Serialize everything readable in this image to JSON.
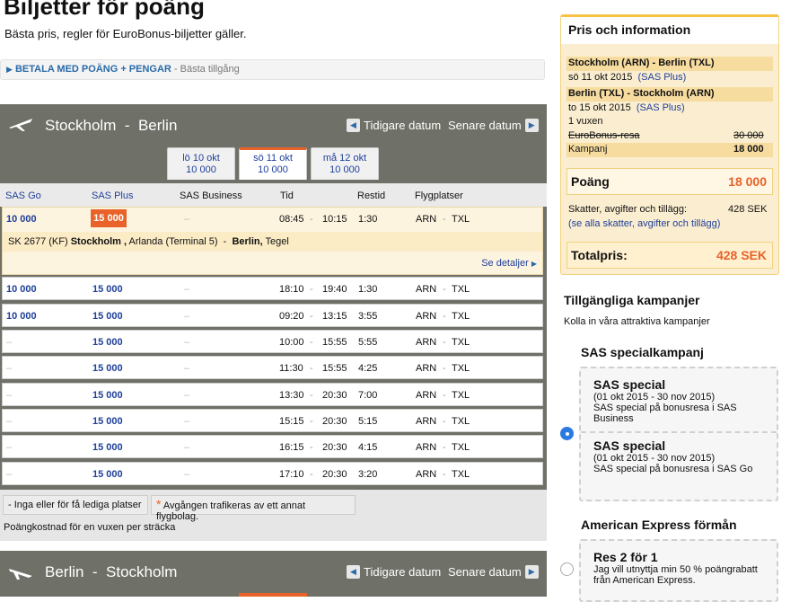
{
  "header": {
    "title": "Biljetter för poäng",
    "subtitle": "Bästa pris, regler för EuroBonus-biljetter gäller.",
    "pay_link": "BETALA MED POÄNG + PENGAR",
    "pay_suffix": "- Bästa tillgång"
  },
  "outbound": {
    "from": "Stockholm",
    "to": "Berlin",
    "prev_label": "Tidigare datum",
    "next_label": "Senare datum",
    "tabs": [
      {
        "day": "lö 10 okt",
        "points": "10 000"
      },
      {
        "day": "sö 11 okt",
        "points": "10 000"
      },
      {
        "day": "må 12 okt",
        "points": "10 000"
      }
    ],
    "columns": [
      "SAS Go",
      "SAS Plus",
      "SAS Business",
      "Tid",
      "Restid",
      "Flygplatser"
    ],
    "rows": [
      {
        "go": "10 000",
        "plus": "15 000",
        "biz": "–",
        "dep": "08:45",
        "arr": "10:15",
        "dur": "1:30",
        "from": "ARN",
        "to": "TXL"
      },
      {
        "go": "10 000",
        "plus": "15 000",
        "biz": "–",
        "dep": "18:10",
        "arr": "19:40",
        "dur": "1:30",
        "from": "ARN",
        "to": "TXL"
      },
      {
        "go": "10 000",
        "plus": "15 000",
        "biz": "–",
        "dep": "09:20",
        "arr": "13:15",
        "dur": "3:55",
        "from": "ARN",
        "to": "TXL"
      },
      {
        "go": "–",
        "plus": "15 000",
        "biz": "–",
        "dep": "10:00",
        "arr": "15:55",
        "dur": "5:55",
        "from": "ARN",
        "to": "TXL"
      },
      {
        "go": "–",
        "plus": "15 000",
        "biz": "–",
        "dep": "11:30",
        "arr": "15:55",
        "dur": "4:25",
        "from": "ARN",
        "to": "TXL"
      },
      {
        "go": "–",
        "plus": "15 000",
        "biz": "–",
        "dep": "13:30",
        "arr": "20:30",
        "dur": "7:00",
        "from": "ARN",
        "to": "TXL"
      },
      {
        "go": "–",
        "plus": "15 000",
        "biz": "–",
        "dep": "15:15",
        "arr": "20:30",
        "dur": "5:15",
        "from": "ARN",
        "to": "TXL"
      },
      {
        "go": "–",
        "plus": "15 000",
        "biz": "–",
        "dep": "16:15",
        "arr": "20:30",
        "dur": "4:15",
        "from": "ARN",
        "to": "TXL"
      },
      {
        "go": "–",
        "plus": "15 000",
        "biz": "–",
        "dep": "17:10",
        "arr": "20:30",
        "dur": "3:20",
        "from": "ARN",
        "to": "TXL"
      }
    ],
    "detail": {
      "flight": "SK 2677 (KF)",
      "from_city": "Stockholm ,",
      "from_airport": "Arlanda  (Terminal 5)",
      "to_city": "Berlin,",
      "to_airport": "Tegel",
      "link": "Se detaljer"
    },
    "legend1": "- Inga eller för få lediga platser",
    "legend2": "Avgången trafikeras av ett annat flygbolag.",
    "note": "Poängkostnad för en vuxen per sträcka"
  },
  "return": {
    "from": "Berlin",
    "to": "Stockholm",
    "prev_label": "Tidigare datum",
    "next_label": "Senare datum"
  },
  "summary": {
    "title": "Pris och information",
    "out_route": "Stockholm (ARN) - Berlin (TXL)",
    "out_date": "sö 11 okt 2015",
    "out_class": "(SAS Plus)",
    "ret_route": "Berlin (TXL) - Stockholm (ARN)",
    "ret_date": "to 15 okt 2015",
    "ret_class": "(SAS Plus)",
    "passengers": "1 vuxen",
    "eb_label": "EuroBonus-resa",
    "eb_value": "30 000",
    "kampanj_label": "Kampanj",
    "kampanj_value": "18 000",
    "poang_label": "Poäng",
    "poang_value": "18 000",
    "tax_label": "Skatter, avgifter och tillägg:",
    "tax_value": "428  SEK",
    "tax_link": "(se alla skatter, avgifter och tillägg)",
    "total_label": "Totalpris:",
    "total_value": "428  SEK"
  },
  "campaigns": {
    "title": "Tillgängliga kampanjer",
    "subtitle": "Kolla in våra attraktiva kampanjer",
    "group1": "SAS specialkampanj",
    "c1_title": "SAS special",
    "c1_dates": "(01 okt 2015 - 30 nov 2015)",
    "c1_desc": "SAS special på bonusresa i SAS Business",
    "c2_title": "SAS special",
    "c2_dates": "(01 okt 2015 - 30 nov 2015)",
    "c2_desc": "SAS special på bonusresa i SAS Go",
    "group2": "American Express förmån",
    "c3_title": "Res 2 för 1",
    "c3_desc": "Jag vill utnyttja min 50 % poängrabatt från American Express."
  }
}
